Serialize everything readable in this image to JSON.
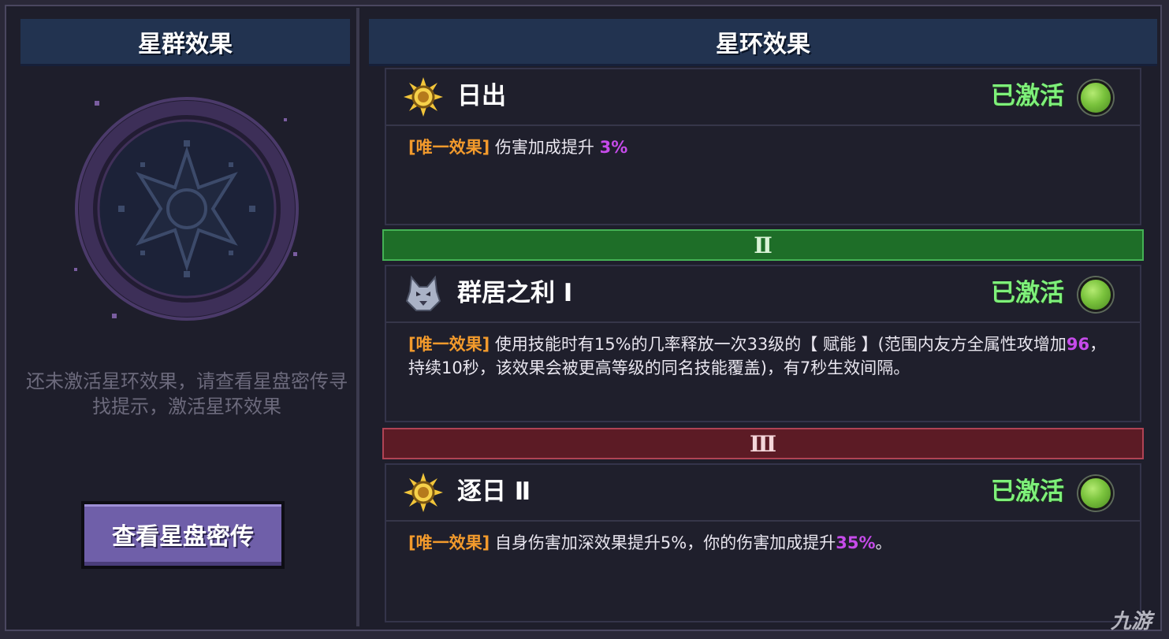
{
  "left_panel": {
    "title": "星群效果",
    "message": "还未激活星环效果，请查看星盘密传寻找提示，激活星环效果",
    "button_label": "查看星盘密传"
  },
  "right_panel": {
    "title": "星环效果",
    "cards": [
      {
        "title": "日出",
        "status": "已激活",
        "tag": "[唯一效果]",
        "desc_1": "伤害加成提升",
        "value_1": "3%",
        "desc_2": "",
        "value_2": "",
        "desc_3": "",
        "icon": "sun-icon"
      },
      {
        "title": "群居之利 Ⅰ",
        "status": "已激活",
        "tag": "[唯一效果]",
        "desc_1": "使用技能时有15%的几率释放一次33级的【 赋能 】(范围内友方全属性攻增加",
        "value_1": "96",
        "desc_2": "，持续10秒，该效果会被更高等级的同名技能覆盖)，有7秒生效间隔。",
        "value_2": "",
        "desc_3": "",
        "icon": "wolf-icon"
      },
      {
        "title": "逐日 Ⅱ",
        "status": "已激活",
        "tag": "[唯一效果]",
        "desc_1": "自身伤害加深效果提升5%，你的伤害加成提升",
        "value_1": "35%",
        "desc_2": "。",
        "value_2": "",
        "desc_3": "",
        "icon": "sun-icon"
      }
    ],
    "tiers": [
      "Ⅱ",
      "Ⅲ"
    ]
  },
  "colors": {
    "active_green": "#7ef07a",
    "tag_orange": "#f29a2c",
    "highlight_purple": "#c64bea",
    "tier2_green": "#1e6e28",
    "tier3_red": "#5c1b25"
  },
  "watermark": "九游"
}
